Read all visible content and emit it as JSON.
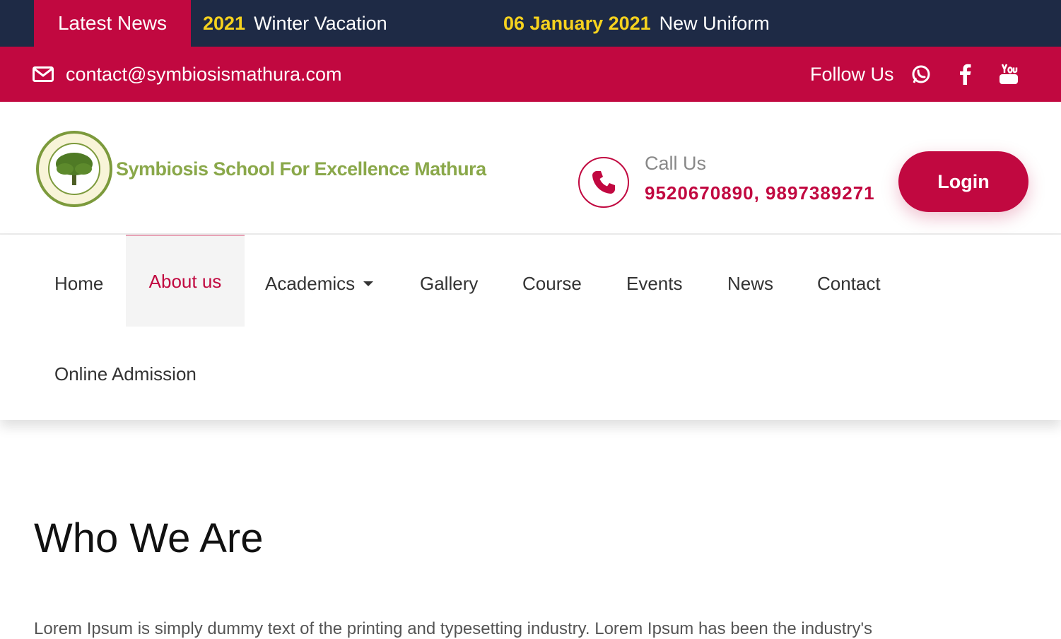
{
  "ticker": {
    "label": "Latest News",
    "items": [
      {
        "date": "2021",
        "text": "Winter Vacation"
      },
      {
        "date": "06 January 2021",
        "text": "New Uniform"
      }
    ]
  },
  "contact_bar": {
    "email": "contact@symbiosismathura.com",
    "follow_label": "Follow Us",
    "social_icons": [
      "whatsapp-icon",
      "facebook-icon",
      "youtube-icon"
    ]
  },
  "header": {
    "school_name": "Symbiosis School For Excellence Mathura",
    "call_label": "Call Us",
    "call_numbers": "9520670890, 9897389271",
    "login_label": "Login"
  },
  "nav": {
    "items": [
      {
        "label": "Home"
      },
      {
        "label": "About us"
      },
      {
        "label": "Academics"
      },
      {
        "label": "Gallery"
      },
      {
        "label": "Course"
      },
      {
        "label": "Events"
      },
      {
        "label": "News"
      },
      {
        "label": "Contact"
      },
      {
        "label": "Online Admission"
      }
    ],
    "active": "About us"
  },
  "main": {
    "title": "Who We Are",
    "intro": "Lorem Ipsum is simply dummy text of the printing and typesetting industry. Lorem Ipsum has been the industry's"
  },
  "colors": {
    "brand": "#c10840",
    "ticker_bg": "#1e2a45",
    "ticker_date": "#f6d21e",
    "logo_green": "#8aa84a"
  }
}
